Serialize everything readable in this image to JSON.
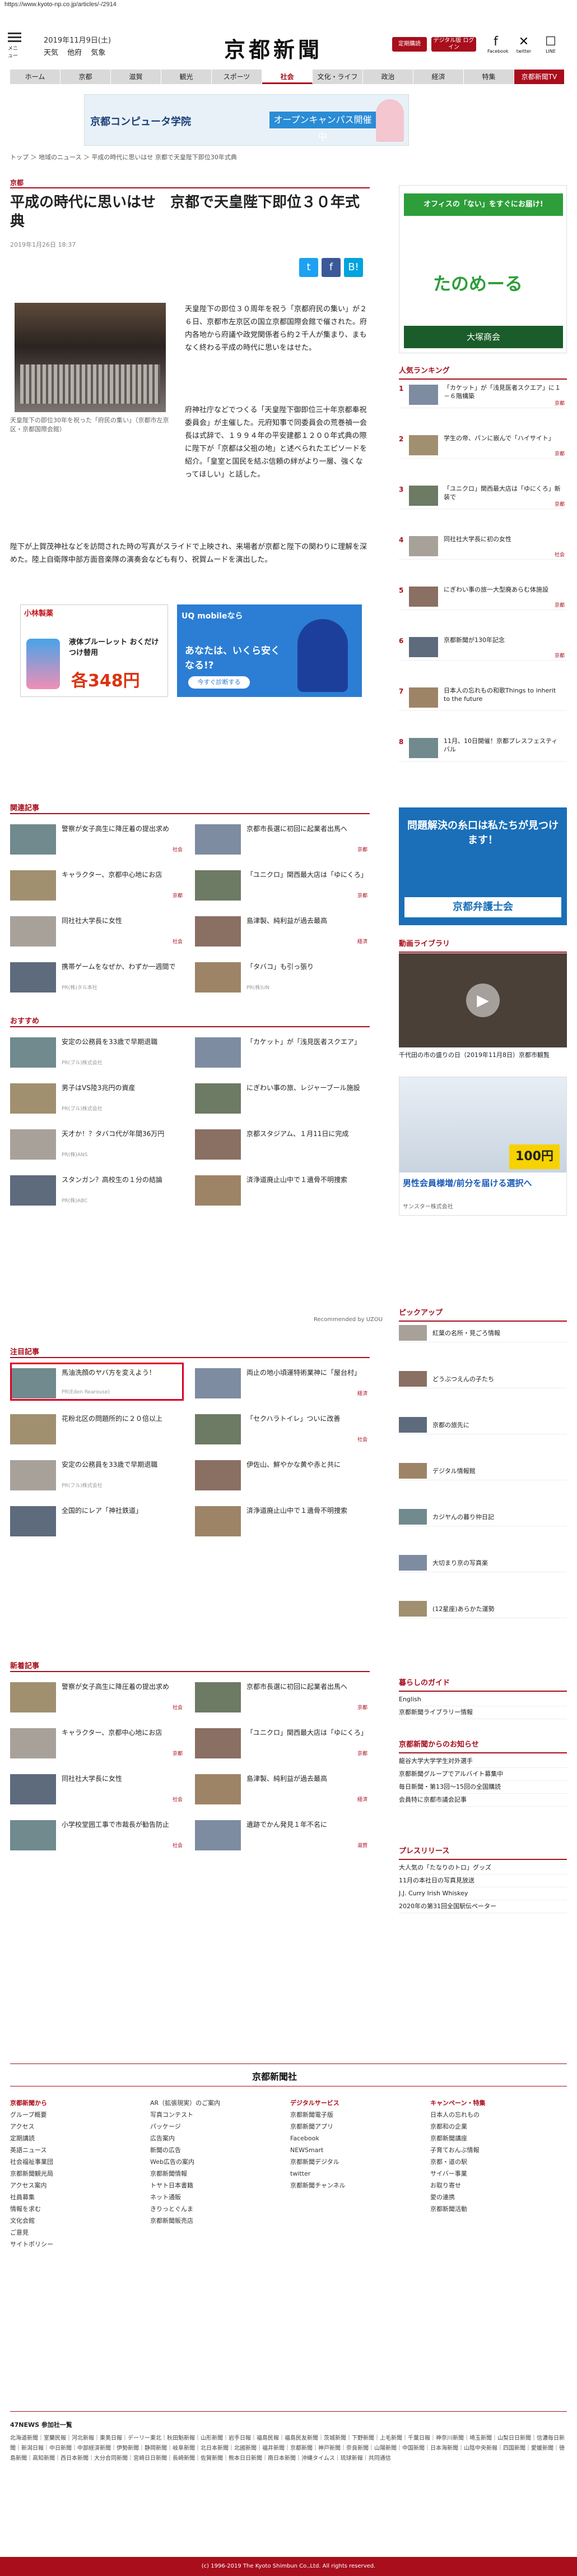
{
  "url": "https://www.kyoto-np.co.jp/articles/-/2914",
  "header": {
    "menu_label": "メニュー",
    "date": "2019年11月9日(土)",
    "weather": [
      "天気",
      "他府",
      "気象"
    ],
    "logo": "京都新聞",
    "btn_shinbun": "定期購読",
    "btn_digital": "デジタル版 ログイン",
    "social": [
      "Facebook",
      "twitter",
      "LINE"
    ]
  },
  "nav": [
    "ホーム",
    "京都",
    "滋賀",
    "観光",
    "スポーツ",
    "社会",
    "文化・ライフ",
    "政治",
    "経済",
    "特集",
    "京都新聞TV"
  ],
  "banner": {
    "school": "京都コンピュータ学院",
    "cta": "オープンキャンパス開催中"
  },
  "breadcrumb": "トップ ＞ 地域のニュース ＞ 平成の時代に思いはせ 京都で天皇陛下即位30年式典",
  "article": {
    "category": "京都",
    "title": "平成の時代に思いはせ　京都で天皇陛下即位３０年式典",
    "date": "2019年1月26日 18:37",
    "caption": "天皇陛下の即位30年を祝った「府民の集い」（京都市左京区・京都国際会館）",
    "p1": "天皇陛下の即位３０周年を祝う「京都府民の集い」が２６日、京都市左京区の国立京都国際会館で催された。府内各地から府議や政党関係者ら約２千人が集まり、まもなく終わる平成の時代に思いをはせた。",
    "p2": "府神社庁などでつくる「天皇陛下御即位三十年京都奉祝委員会」が主催した。元府知事で同委員会の荒巻禎一会長は式辞で、１９９４年の平安建都１２００年式典の際に陛下が「京都は父祖の地」と述べられたエピソードを紹介。「皇室と国民を結ぶ信頼の絆がより一層、強くなってほしい」と話した。",
    "p3": "陛下が上賀茂神社などを訪問された時の写真がスライドで上映され、来場者が京都と陛下の関わりに理解を深めた。陸上自衛隊中部方面音楽隊の演奏会なども有り、祝賀ムードを演出した。"
  },
  "ads": {
    "kobayashi": "小林製薬",
    "kobayashi_item": "液体ブルーレット おくだけ つけ替用",
    "kobayashi_price": "各348円",
    "uq_top": "UQ mobileなら",
    "uq_mid": "あなたは、いくら安くなる!?",
    "uq_btn": "今すぐ診断する"
  },
  "related": {
    "heading": "関連記事",
    "items": [
      {
        "text": "警察が女子高生に降圧着の提出求め",
        "tag": "社会"
      },
      {
        "text": "京都市長選に初回に起業者出馬へ",
        "tag": "京都"
      },
      {
        "text": "キャラクター、京都中心地にお店",
        "tag": "京都"
      },
      {
        "text": "「ユニクロ」関西最大店は「ゆにくろ」",
        "tag": "京都"
      },
      {
        "text": "同社社大学長に女性",
        "tag": "社会"
      },
      {
        "text": "島津製、純利益が過去最高",
        "tag": "経済"
      },
      {
        "text": "携帯ゲームをなぜか、わずか一週間で",
        "sp": "PR(株)タル本社"
      },
      {
        "text": "「タバコ」も引っ張り",
        "sp": "PR(株)UN"
      }
    ]
  },
  "osusume": {
    "heading": "おすすめ",
    "items": [
      {
        "text": "安定の公務員を33歳で早期退職",
        "sp": "PR(ブル)株式会社"
      },
      {
        "text": "「カケット」が「浅見医者スクエア」",
        "tag": ""
      },
      {
        "text": "男子はVS陸3兆円の資産",
        "sp": "PR(ブル)株式会社"
      },
      {
        "text": "にぎわい事の旅、レジャーブール施設",
        "tag": ""
      },
      {
        "text": "天才か！？タバコ代が年間36万円",
        "sp": "PR(株)ANS"
      },
      {
        "text": "京都スタジアム、１月11日に完成",
        "tag": ""
      },
      {
        "text": "スタンガン？高校生の１分の結論",
        "sp": "PR(株)ABC"
      },
      {
        "text": "済浄道廃止山中で１遺骨不明捜索",
        "tag": ""
      }
    ],
    "recommended": "Recommended by UZOU"
  },
  "chumoku": {
    "heading": "注目記事",
    "items": [
      {
        "text": "馬油洗顔のヤバ方を変えよう！",
        "sp": "PR(Eden Rearouse)"
      },
      {
        "text": "両止の地小頃運特術業神に「屋台村」",
        "tag": "経済"
      },
      {
        "text": "花粉北区の問題所的に２０倍以上",
        "tag": ""
      },
      {
        "text": "「セクハラトイレ」ついに改善",
        "tag": "社会"
      },
      {
        "text": "安定の公務員を33歳で早期退職",
        "sp": "PR(フル)株式会社"
      },
      {
        "text": "伊佐山、鮮やかな黄や赤と共に",
        "tag": ""
      },
      {
        "text": "全国的にレア「神社鉄道」",
        "tag": ""
      },
      {
        "text": "済浄道廃止山中で１遺骨不明捜索",
        "tag": ""
      }
    ]
  },
  "shinchaku": {
    "heading": "新着記事",
    "items": [
      {
        "text": "警察が女子高生に降圧着の提出求め",
        "tag": "社会"
      },
      {
        "text": "京都市長選に初回に起業者出馬へ",
        "tag": "京都"
      },
      {
        "text": "キャラクター、京都中心地にお店",
        "tag": "京都"
      },
      {
        "text": "「ユニクロ」関西最大店は「ゆにくろ」",
        "tag": "京都"
      },
      {
        "text": "同社社大学長に女性",
        "tag": "社会"
      },
      {
        "text": "島津製、純利益が過去最高",
        "tag": "経済"
      },
      {
        "text": "小学校堂囲工事で市裁長が勧告防止",
        "tag": "社会"
      },
      {
        "text": "遺跡でかん発見１年不名に",
        "tag": "滋賀"
      }
    ]
  },
  "sidebar": {
    "ad_title": "オフィスの「ない」をすぐにお届け!",
    "ad_brand": "たのめーる",
    "ad_company": "大塚商会",
    "ranking_heading": "人気ランキング",
    "ranking": [
      {
        "n": "1",
        "text": "「カケット」が「浅見医者スクエア」に１－６階構築",
        "tag": "京都"
      },
      {
        "n": "2",
        "text": "学生の帝、パンに嵌んで「ハイサイト」",
        "tag": "京都"
      },
      {
        "n": "3",
        "text": "「ユニクロ」関西最大店は「ゆにくろ」新装で",
        "tag": "京都"
      },
      {
        "n": "4",
        "text": "同社社大学長に初の女性",
        "tag": "社会"
      },
      {
        "n": "5",
        "text": "にぎわい事の旅一大型廃あらむ体施設",
        "tag": "京都"
      },
      {
        "n": "6",
        "text": "京都新聞が130年記念",
        "tag": "京都"
      },
      {
        "n": "7",
        "text": "日本人の忘れもの和歌Things to inherit to the future",
        "tag": ""
      },
      {
        "n": "8",
        "text": "11月、10日開催！京都プレスフェスティバル",
        "tag": ""
      }
    ],
    "bengoshi_title": "問題解決の糸口は私たちが見つけます！",
    "bengoshi": "京都弁護士会",
    "video_heading": "動画ライブラリ",
    "video_caption": "千代田の市の盛りの日（2019年11月8日）京都市観覧",
    "ad3_title": "男性会員様増/前分を届ける選択へ",
    "ad3_sub": "サンスター株式会社",
    "ad3_price": "100円",
    "pickup_heading": "ピックアップ",
    "pickup": [
      "紅葉の名所・見ごろ情報",
      "どうぶつえんの子たち",
      "京都の旅先に",
      "デジタル情報館",
      "カジヤんの暮り仲日記",
      "大切まり京の写真楽",
      "(12星座)あらかた運勢"
    ],
    "guide_heading": "暮らしのガイド",
    "guide": [
      "English",
      "京都新聞ライブラリー情報"
    ],
    "notice_heading": "京都新聞からのお知らせ",
    "notices": [
      "龍谷大学大学学生対外選手",
      "京都新聞グループでアルバイト募集中",
      "毎日新聞・第13回～15回の全国購読",
      "会員特に京都市議会記事"
    ],
    "press_heading": "プレスリリース",
    "press": [
      "大人気の「たなりのトロ」グッズ",
      "11月の本社日の写真見放送",
      "J.J. Curry Irish Whiskey",
      "2020年の第31回全国駅伝ペーター"
    ]
  },
  "footer": {
    "logo": "京都新聞社",
    "cols": [
      {
        "head": "京都新聞から",
        "items": [
          "グループ概要",
          "アクセス",
          "定期講読",
          "英語ニュース",
          "社会福祉事業団",
          "京都新聞観光局",
          "アクセス案内",
          "社員募集",
          "情報を求む",
          "文化会館",
          "ご意見",
          "サイトポリシー"
        ]
      },
      {
        "head": "",
        "items": [
          "AR（拡張現実）のご案内",
          "写真コンテスト",
          "パッケージ",
          "広告案内",
          "新聞の広告",
          "Web広告の案内",
          "京都新聞情報",
          "トヤト日本書籍",
          "ネット通販",
          "きりっとぐんま",
          "京都新聞販売店"
        ]
      },
      {
        "head": "デジタルサービス",
        "items": [
          "京都新聞電子版",
          "京都新聞アプリ",
          "Facebook",
          "NEWSmart",
          "京都新聞デジタル",
          "twitter",
          "京都新聞チャンネル"
        ]
      },
      {
        "head": "キャンペーン・特集",
        "items": [
          "日本人の忘れもの",
          "京都和の企業",
          "京都新聞講座",
          "子育ておんぶ情報",
          "京都・道の駅",
          "サイバー事業",
          "お取り寄せ",
          "愛の連携",
          "京都新聞活動"
        ]
      }
    ],
    "prefs_heading": "47NEWS 参加社一覧",
    "prefs": "北海道新聞｜室蘭民報｜河北新報｜東奥日報｜デーリー東北｜秋田魁新報｜山形新聞｜岩手日報｜福島民報｜福島民友新聞｜茨城新聞｜下野新聞｜上毛新聞｜千葉日報｜神奈川新聞｜埼玉新聞｜山梨日日新聞｜信濃毎日新聞｜新潟日報｜中日新聞｜中部経済新聞｜伊勢新聞｜静岡新聞｜岐阜新聞｜北日本新聞｜北國新聞｜福井新聞｜京都新聞｜神戸新聞｜奈良新聞｜山陽新聞｜中国新聞｜日本海新聞｜山陰中央新報｜四国新聞｜愛媛新聞｜徳島新聞｜高知新聞｜西日本新聞｜大分合同新聞｜宮崎日日新聞｜長崎新聞｜佐賀新聞｜熊本日日新聞｜南日本新聞｜沖縄タイムス｜琉球新報｜共同通信",
    "copyright": "(c) 1996-2019 The Kyoto Shimbun Co.,Ltd. All rights reserved."
  },
  "colors": {
    "brand": "#a80e1c",
    "nav_bg": "#d9d9d9",
    "twitter": "#1da1f2",
    "facebook": "#3b5998",
    "hatena": "#00a4de"
  }
}
